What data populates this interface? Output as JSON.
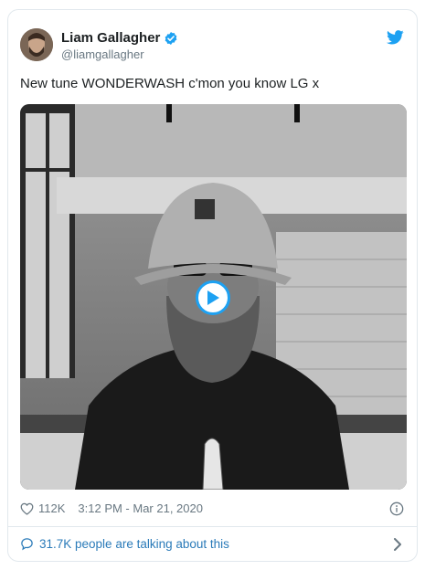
{
  "author": {
    "name": "Liam Gallagher",
    "handle": "@liamgallagher"
  },
  "tweet": {
    "text": "New tune WONDERWASH c'mon you know LG x"
  },
  "stats": {
    "likes": "112K",
    "timestamp": "3:12 PM - Mar 21, 2020"
  },
  "footer": {
    "talking_label": "31.7K people are talking about this"
  },
  "colors": {
    "accent": "#1da1f2",
    "link": "#2b7bb9",
    "muted": "#697882"
  },
  "icons": [
    "verified-badge-icon",
    "twitter-bird-icon",
    "play-icon",
    "heart-icon",
    "info-icon",
    "speech-bubble-icon",
    "chevron-right-icon"
  ]
}
